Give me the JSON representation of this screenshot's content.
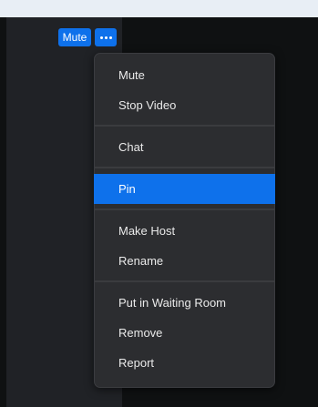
{
  "tile": {
    "mute_label": "Mute",
    "more_icon": "more-horizontal-icon"
  },
  "menu": {
    "groups": [
      [
        "Mute",
        "Stop Video"
      ],
      [
        "Chat"
      ],
      [
        "Pin"
      ],
      [
        "Make Host",
        "Rename"
      ],
      [
        "Put in Waiting Room",
        "Remove",
        "Report"
      ]
    ],
    "highlighted": "Pin"
  },
  "colors": {
    "accent": "#0e71eb",
    "menu_bg": "#2c2d30",
    "tile_bg": "#202226",
    "page_bg": "#0f1112"
  }
}
